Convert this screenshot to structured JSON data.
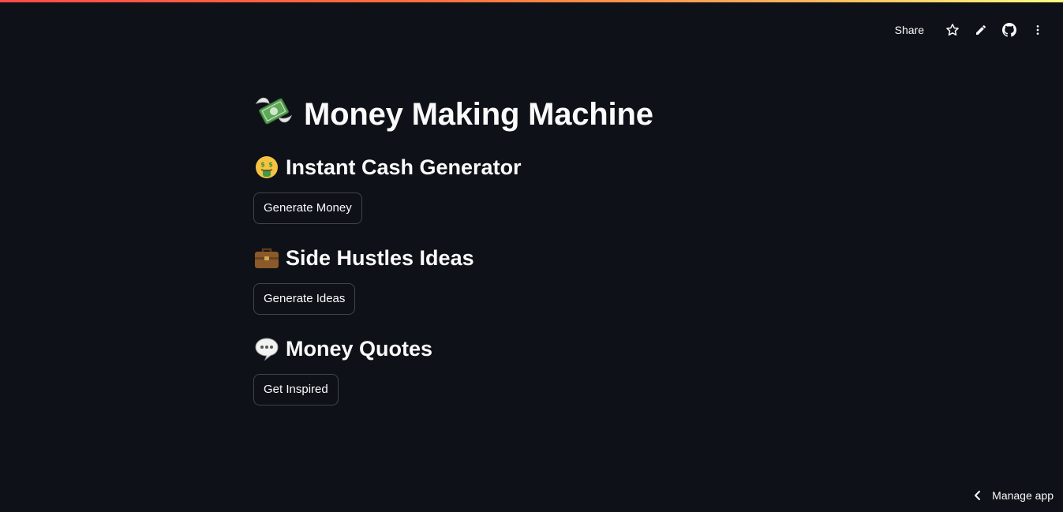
{
  "header": {
    "share_label": "Share",
    "icons": [
      "star-icon",
      "pencil-icon",
      "github-icon",
      "kebab-menu-icon"
    ]
  },
  "main": {
    "title": {
      "emoji": "💸",
      "text": "Money Making Machine"
    },
    "sections": [
      {
        "emoji": "🤑",
        "heading": "Instant Cash Generator",
        "button_label": "Generate Money"
      },
      {
        "emoji": "💼",
        "heading": "Side Hustles Ideas",
        "button_label": "Generate Ideas"
      },
      {
        "emoji": "💬",
        "heading": "Money Quotes",
        "button_label": "Get Inspired"
      }
    ]
  },
  "footer": {
    "manage_app_label": "Manage app"
  },
  "colors": {
    "background": "#0e1117",
    "text": "#fafafa",
    "button_border": "rgba(250,250,250,0.22)"
  }
}
